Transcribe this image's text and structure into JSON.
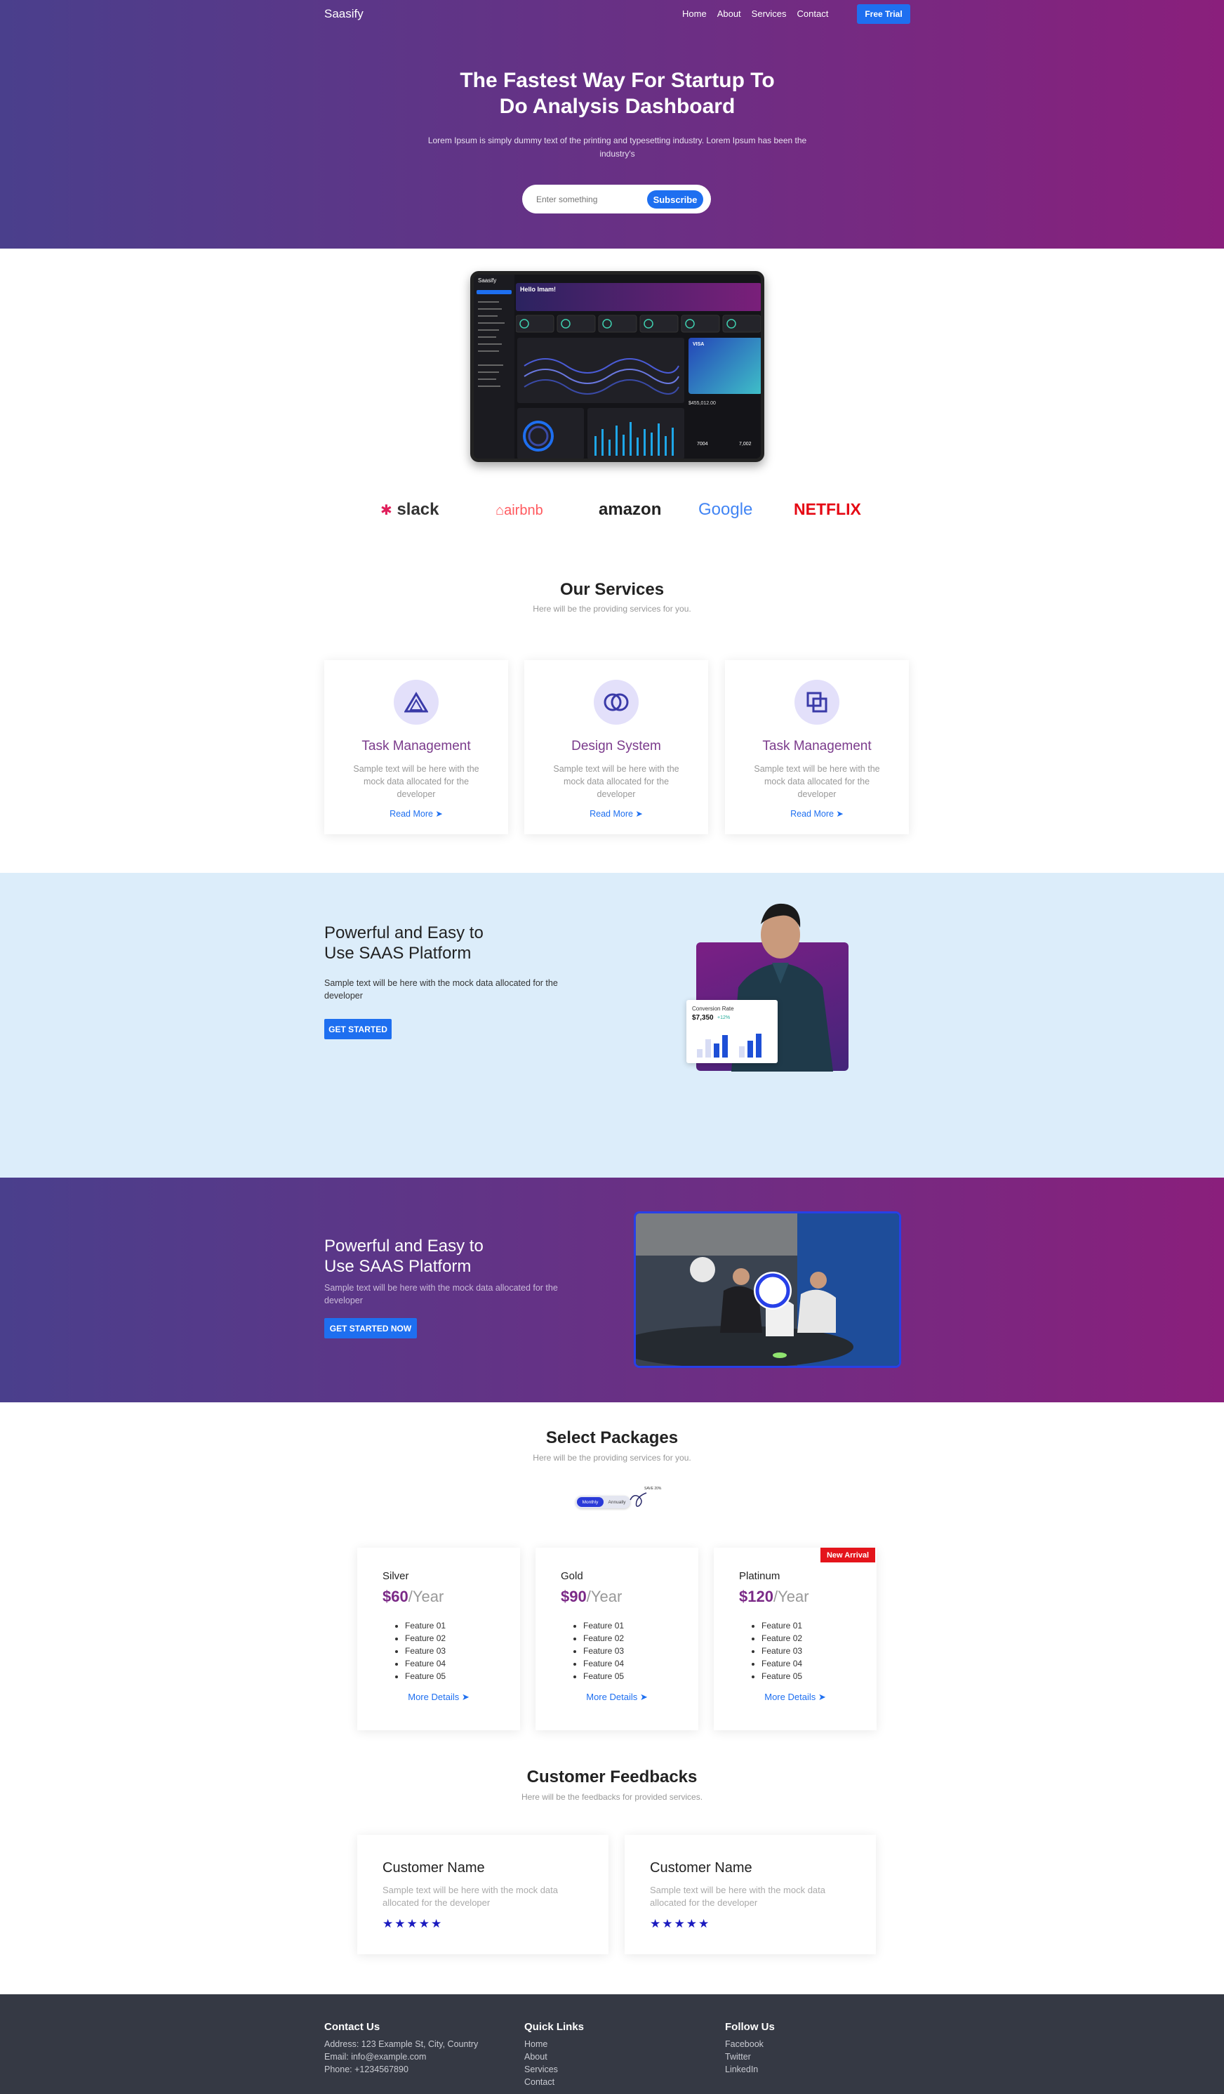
{
  "header": {
    "logo": "Saasify",
    "nav": [
      "Home",
      "About",
      "Services",
      "Contact"
    ],
    "cta": "Free Trial"
  },
  "hero": {
    "title_line1": "The Fastest Way For Startup To",
    "title_line2": "Do Analysis Dashboard",
    "subtitle": "Lorem Ipsum is simply dummy text of the printing and typesetting industry. Lorem Ipsum has been the industry's",
    "input_placeholder": "Enter something",
    "subscribe": "Subscribe"
  },
  "dashboard": {
    "app": "Saasify",
    "greeting": "Hello Imam!",
    "card_brand": "VISA",
    "balance": "$455,012.00",
    "stat1": "7004",
    "stat2": "7,002"
  },
  "brands": [
    "slack",
    "airbnb",
    "amazon",
    "Google",
    "NETFLIX"
  ],
  "services": {
    "title": "Our Services",
    "subtitle": "Here will be the providing services for you.",
    "cards": [
      {
        "title": "Task Management",
        "desc": "Sample text will be here with the mock data allocated for the developer",
        "link": "Read More ➤",
        "icon": "triangle-icon"
      },
      {
        "title": "Design System",
        "desc": "Sample text will be here with the mock data allocated for the developer",
        "link": "Read More ➤",
        "icon": "overlap-circles-icon"
      },
      {
        "title": "Task Management",
        "desc": "Sample text will be here with the mock data allocated for the developer",
        "link": "Read More ➤",
        "icon": "overlap-squares-icon"
      }
    ]
  },
  "platform": {
    "title_line1": "Powerful and Easy to",
    "title_line2": "Use SAAS Platform",
    "desc": "Sample text will be here with the mock data allocated for the developer",
    "cta": "GET STARTED",
    "widget_label": "Conversion Rate",
    "widget_value": "$7,350",
    "widget_delta": "+12%"
  },
  "platform2": {
    "title_line1": "Powerful and Easy to",
    "title_line2": "Use SAAS Platform",
    "desc": "Sample text will be here with the mock data allocated for the developer",
    "cta": "GET STARTED NOW"
  },
  "packages": {
    "title": "Select Packages",
    "subtitle": "Here will be the providing services for you.",
    "toggle": [
      "Monthly",
      "Annually"
    ],
    "toggle_note": "SAVE 20%",
    "badge": "New Arrival",
    "plans": [
      {
        "name": "Silver",
        "price": "$60",
        "period": "/Year",
        "features": [
          "Feature 01",
          "Feature 02",
          "Feature 03",
          "Feature 04",
          "Feature 05"
        ],
        "link": "More Details ➤"
      },
      {
        "name": "Gold",
        "price": "$90",
        "period": "/Year",
        "features": [
          "Feature 01",
          "Feature 02",
          "Feature 03",
          "Feature 04",
          "Feature 05"
        ],
        "link": "More Details ➤"
      },
      {
        "name": "Platinum",
        "price": "$120",
        "period": "/Year",
        "features": [
          "Feature 01",
          "Feature 02",
          "Feature 03",
          "Feature 04",
          "Feature 05"
        ],
        "link": "More Details ➤"
      }
    ]
  },
  "feedbacks": {
    "title": "Customer Feedbacks",
    "subtitle": "Here will be the feedbacks for provided services.",
    "items": [
      {
        "name": "Customer Name",
        "text": "Sample text will be here with the mock data allocated for the developer",
        "stars": "★★★★★",
        "rating": 5
      },
      {
        "name": "Customer Name",
        "text": "Sample text will be here with the mock data allocated for the developer",
        "stars": "★★★★★",
        "rating": 5
      }
    ]
  },
  "footer": {
    "contact": {
      "title": "Contact Us",
      "address": "Address: 123 Example St, City, Country",
      "email": "Email: info@example.com",
      "phone": "Phone: +1234567890"
    },
    "links": {
      "title": "Quick Links",
      "items": [
        "Home",
        "About",
        "Services",
        "Contact"
      ]
    },
    "follow": {
      "title": "Follow Us",
      "items": [
        "Facebook",
        "Twitter",
        "LinkedIn"
      ]
    }
  },
  "colors": {
    "accent": "#1e6ff0",
    "purple": "#7b2a87",
    "light_blue": "#dcedfa",
    "footer": "#353944",
    "badge": "#e4141b",
    "star": "#1b1bbf"
  }
}
